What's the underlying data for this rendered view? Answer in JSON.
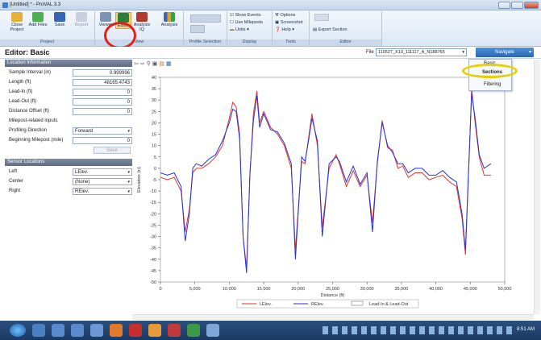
{
  "window": {
    "title": "[Untitled] * - ProVAL 3.3"
  },
  "ribbon": {
    "groups": {
      "project": "Project",
      "view": "View",
      "profile_selection": "Profile Selection",
      "display": "Display",
      "tools": "Tools",
      "editor": "Editor"
    },
    "buttons": {
      "close_project": "Close\nProject",
      "add_files": "Add Files",
      "save": "Save",
      "report": "Report",
      "viewer": "Viewer",
      "editor": "Editor",
      "analysis_iq": "Analysis\nIQ",
      "analysis": "Analysis"
    },
    "display": {
      "show_events": "Show Events",
      "use_mileposts": "Use Mileposts",
      "units": "Units"
    },
    "tools": {
      "options": "Options",
      "screenshot": "Screenshot",
      "help": "Help"
    },
    "editor": {
      "export_section": "Export Section"
    }
  },
  "editor_bar": {
    "title": "Editor: Basic",
    "file_label": "File",
    "file_value": "110527_X10_111117_A_N188765",
    "navigate": "Navigate",
    "navigate_menu": [
      "Basic",
      "Sections",
      "Filtering"
    ]
  },
  "location_info": {
    "header": "Location Information",
    "rows": [
      {
        "label": "Sample Interval (in)",
        "value": "0.999996"
      },
      {
        "label": "Length (ft)",
        "value": "48165.4743"
      },
      {
        "label": "Lead-In (ft)",
        "value": "0"
      },
      {
        "label": "Lead-Out (ft)",
        "value": "0"
      },
      {
        "label": "Distance Offset (ft)",
        "value": "0"
      }
    ],
    "milepost_label": "Milepost-related inputs",
    "profiling_direction_label": "Profiling Direction",
    "profiling_direction_value": "Forward",
    "beginning_milepost_label": "Beginning Milepost (mile)",
    "beginning_milepost_value": "0",
    "save_label": "Save"
  },
  "sensor_locations": {
    "header": "Sensor Locations",
    "rows": [
      {
        "label": "Left",
        "value": "LElev."
      },
      {
        "label": "Center",
        "value": "(None)"
      },
      {
        "label": "Right",
        "value": "RElev."
      }
    ]
  },
  "taskbar": {
    "clock": "8:51 AM"
  },
  "colors": {
    "left_series": "#e8322a",
    "right_series": "#2233dd",
    "accent": "#2a66b2",
    "highlight_red": "#e0201a",
    "highlight_yellow": "#e5d000"
  },
  "chart_data": {
    "type": "line",
    "xlabel": "Distance (ft)",
    "ylabel": "Elevation (in)",
    "xlim": [
      0,
      50000
    ],
    "ylim": [
      -50,
      40
    ],
    "xticks": [
      0,
      5000,
      10000,
      15000,
      20000,
      25000,
      30000,
      35000,
      40000,
      45000,
      50000
    ],
    "xtick_labels": [
      "0",
      "5,000",
      "10,000",
      "15,000",
      "20,000",
      "25,000",
      "30,000",
      "35,000",
      "40,000",
      "45,000",
      "50,000"
    ],
    "yticks": [
      40,
      35,
      30,
      25,
      20,
      15,
      10,
      5,
      0,
      -5,
      -10,
      -15,
      -20,
      -25,
      -30,
      -35,
      -40,
      -45,
      -50
    ],
    "legend_position": "bottom",
    "series": [
      {
        "name": "LElev.",
        "x": [
          0,
          1000,
          2000,
          3000,
          3600,
          4200,
          4700,
          5200,
          6000,
          7000,
          8000,
          9000,
          10000,
          10500,
          11000,
          11500,
          12000,
          12500,
          13000,
          13500,
          14000,
          14400,
          15000,
          16000,
          17000,
          18000,
          19000,
          19600,
          20500,
          21000,
          21500,
          22000,
          22800,
          23500,
          24500,
          25500,
          26000,
          27000,
          28000,
          29000,
          30000,
          30800,
          31500,
          32200,
          33000,
          33700,
          34500,
          35200,
          36000,
          37000,
          38000,
          39000,
          40000,
          41000,
          42000,
          43000,
          43800,
          44300,
          44800,
          45200,
          45700,
          46300,
          47000,
          48000
        ],
        "y": [
          -4,
          -5,
          -4,
          -10,
          -28,
          -18,
          -2,
          0,
          0,
          2,
          5,
          10,
          22,
          29,
          27,
          15,
          -30,
          -44,
          -3,
          24,
          34,
          20,
          25,
          18,
          15,
          10,
          0,
          -36,
          3,
          2,
          13,
          24,
          10,
          -26,
          0,
          6,
          2,
          -8,
          -1,
          -8,
          -3,
          -24,
          2,
          21,
          9,
          8,
          0,
          1,
          -4,
          -2,
          -2,
          -5,
          -4,
          -3,
          -6,
          -8,
          -22,
          -38,
          2,
          35,
          20,
          5,
          -3,
          -3
        ]
      },
      {
        "name": "RElev.",
        "x": [
          0,
          1000,
          2000,
          3000,
          3600,
          4200,
          4700,
          5200,
          6000,
          7000,
          8000,
          9000,
          10000,
          10500,
          11000,
          11500,
          12000,
          12500,
          13000,
          13500,
          14000,
          14400,
          15000,
          16000,
          17000,
          18000,
          19000,
          19600,
          20500,
          21000,
          21500,
          22000,
          22800,
          23500,
          24500,
          25500,
          26000,
          27000,
          28000,
          29000,
          30000,
          30800,
          31500,
          32200,
          33000,
          33700,
          34500,
          35200,
          36000,
          37000,
          38000,
          39000,
          40000,
          41000,
          42000,
          43000,
          43800,
          44300,
          44800,
          45200,
          45700,
          46300,
          47000,
          48000
        ],
        "y": [
          -2,
          -3,
          -2,
          -8,
          -32,
          -20,
          0,
          2,
          1,
          4,
          6,
          12,
          20,
          26,
          25,
          13,
          -30,
          -46,
          -2,
          21,
          32,
          18,
          24,
          17,
          16,
          11,
          2,
          -40,
          5,
          3,
          12,
          22,
          12,
          -30,
          2,
          5,
          3,
          -6,
          1,
          -7,
          -2,
          -28,
          3,
          20,
          10,
          7,
          2,
          2,
          -2,
          0,
          0,
          -3,
          -3,
          -1,
          -4,
          -6,
          -20,
          -36,
          3,
          33,
          22,
          6,
          0,
          2
        ]
      },
      {
        "name": "Lead-In & Lead-Out"
      }
    ]
  }
}
